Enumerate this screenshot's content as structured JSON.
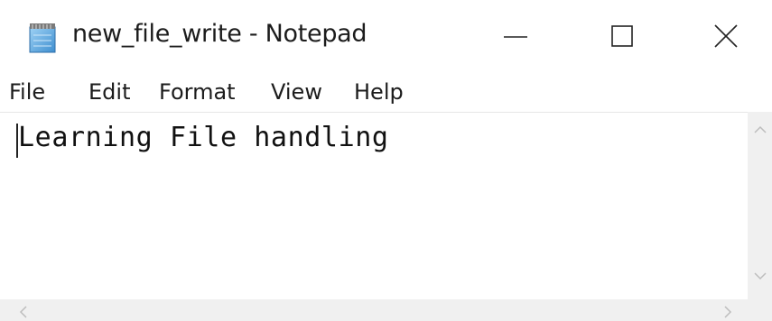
{
  "window": {
    "title": "new_file_write - Notepad",
    "icon": "notepad-icon"
  },
  "controls": {
    "minimize_icon": "minimize-icon",
    "maximize_icon": "maximize-icon",
    "close_icon": "close-icon"
  },
  "menu": {
    "items": [
      {
        "label": "File"
      },
      {
        "label": "Edit"
      },
      {
        "label": "Format"
      },
      {
        "label": "View"
      },
      {
        "label": "Help"
      }
    ]
  },
  "editor": {
    "content": "Learning File handling"
  },
  "scrollbars": {
    "up_icon": "chevron-up-icon",
    "down_icon": "chevron-down-icon",
    "left_icon": "chevron-left-icon",
    "right_icon": "chevron-right-icon"
  }
}
